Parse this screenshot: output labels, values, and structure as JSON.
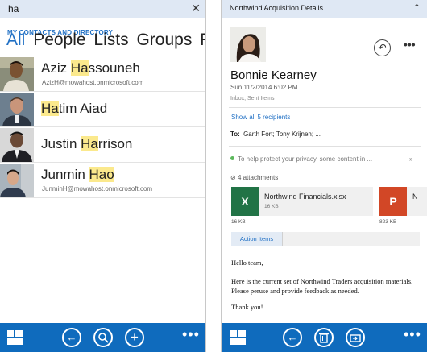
{
  "left": {
    "search": {
      "query": "ha"
    },
    "directory_title": "MY CONTACTS AND DIRECTORY",
    "pivots": [
      "All",
      "People",
      "Lists",
      "Groups",
      "R"
    ],
    "contacts": [
      {
        "name_pre": "Aziz ",
        "name_hl": "Ha",
        "name_post": "ssouneh",
        "email": "AzizH@mowahost.onmicrosoft.com"
      },
      {
        "name_pre": "",
        "name_hl": "Ha",
        "name_post": "tim Aiad",
        "email": ""
      },
      {
        "name_pre": "Justin ",
        "name_hl": "Ha",
        "name_post": "rrison",
        "email": ""
      },
      {
        "name_pre": "Junmin ",
        "name_hl": "Hao",
        "name_post": "",
        "email": "JunminH@mowahost.onmicrosoft.com"
      }
    ],
    "appbar": {
      "icons": [
        "tiles-icon",
        "back-icon",
        "search-icon",
        "add-icon",
        "more-icon"
      ]
    }
  },
  "right": {
    "header_title": "Northwind Acquisition Details",
    "sender": "Bonnie Kearney",
    "date": "Sun 11/2/2014 6:02 PM",
    "folder": "Inbox; Sent Items",
    "show_recipients": "Show all 5 recipients",
    "to_label": "To:",
    "to_names": "Garth Fort;  Tony Krijnen;  ...",
    "privacy": "To help protect your privacy, some content in ...",
    "attachments_count": "4 attachments",
    "attachments": [
      {
        "name": "Northwind Financials.xlsx",
        "size": "16 KB",
        "icon": "excel-icon",
        "color": "#217346",
        "letter": "X"
      },
      {
        "name": "N",
        "size": "823 KB",
        "icon": "powerpoint-icon",
        "color": "#d24726",
        "letter": "P"
      }
    ],
    "action_tab": "Action Items",
    "body": {
      "greeting": "Hello team,",
      "paragraph": "Here is the current set of Northwind Traders acquisition materials. Please peruse and provide feedback as needed.",
      "closing": "Thank you!"
    },
    "appbar": {
      "icons": [
        "tiles-icon",
        "back-icon",
        "delete-icon",
        "move-icon",
        "more-icon"
      ]
    }
  },
  "colors": {
    "accent": "#0f6bbd",
    "link": "#1f6fc4",
    "highlight": "#fbe98d",
    "header_bg": "#dfe8f4"
  }
}
